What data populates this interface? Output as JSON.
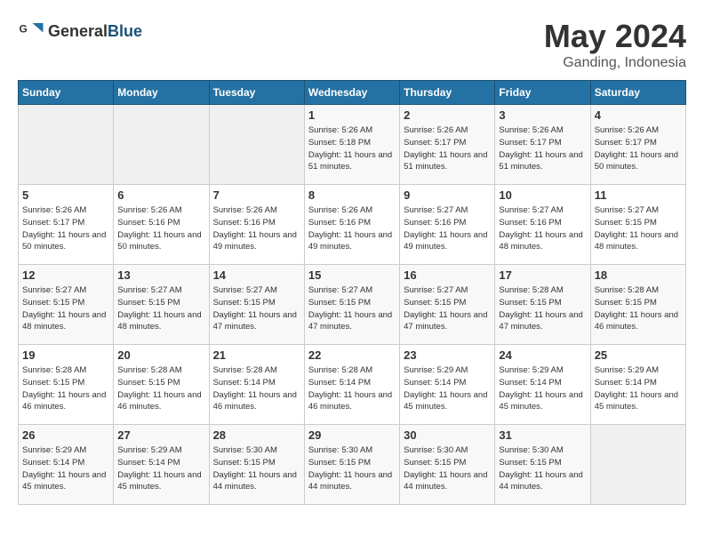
{
  "header": {
    "logo_general": "General",
    "logo_blue": "Blue",
    "month_title": "May 2024",
    "location": "Ganding, Indonesia"
  },
  "days_of_week": [
    "Sunday",
    "Monday",
    "Tuesday",
    "Wednesday",
    "Thursday",
    "Friday",
    "Saturday"
  ],
  "weeks": [
    {
      "cells": [
        {
          "empty": true
        },
        {
          "empty": true
        },
        {
          "empty": true
        },
        {
          "day": "1",
          "sunrise": "5:26 AM",
          "sunset": "5:18 PM",
          "daylight": "11 hours and 51 minutes."
        },
        {
          "day": "2",
          "sunrise": "5:26 AM",
          "sunset": "5:17 PM",
          "daylight": "11 hours and 51 minutes."
        },
        {
          "day": "3",
          "sunrise": "5:26 AM",
          "sunset": "5:17 PM",
          "daylight": "11 hours and 51 minutes."
        },
        {
          "day": "4",
          "sunrise": "5:26 AM",
          "sunset": "5:17 PM",
          "daylight": "11 hours and 50 minutes."
        }
      ]
    },
    {
      "cells": [
        {
          "day": "5",
          "sunrise": "5:26 AM",
          "sunset": "5:17 PM",
          "daylight": "11 hours and 50 minutes."
        },
        {
          "day": "6",
          "sunrise": "5:26 AM",
          "sunset": "5:16 PM",
          "daylight": "11 hours and 50 minutes."
        },
        {
          "day": "7",
          "sunrise": "5:26 AM",
          "sunset": "5:16 PM",
          "daylight": "11 hours and 49 minutes."
        },
        {
          "day": "8",
          "sunrise": "5:26 AM",
          "sunset": "5:16 PM",
          "daylight": "11 hours and 49 minutes."
        },
        {
          "day": "9",
          "sunrise": "5:27 AM",
          "sunset": "5:16 PM",
          "daylight": "11 hours and 49 minutes."
        },
        {
          "day": "10",
          "sunrise": "5:27 AM",
          "sunset": "5:16 PM",
          "daylight": "11 hours and 48 minutes."
        },
        {
          "day": "11",
          "sunrise": "5:27 AM",
          "sunset": "5:15 PM",
          "daylight": "11 hours and 48 minutes."
        }
      ]
    },
    {
      "cells": [
        {
          "day": "12",
          "sunrise": "5:27 AM",
          "sunset": "5:15 PM",
          "daylight": "11 hours and 48 minutes."
        },
        {
          "day": "13",
          "sunrise": "5:27 AM",
          "sunset": "5:15 PM",
          "daylight": "11 hours and 48 minutes."
        },
        {
          "day": "14",
          "sunrise": "5:27 AM",
          "sunset": "5:15 PM",
          "daylight": "11 hours and 47 minutes."
        },
        {
          "day": "15",
          "sunrise": "5:27 AM",
          "sunset": "5:15 PM",
          "daylight": "11 hours and 47 minutes."
        },
        {
          "day": "16",
          "sunrise": "5:27 AM",
          "sunset": "5:15 PM",
          "daylight": "11 hours and 47 minutes."
        },
        {
          "day": "17",
          "sunrise": "5:28 AM",
          "sunset": "5:15 PM",
          "daylight": "11 hours and 47 minutes."
        },
        {
          "day": "18",
          "sunrise": "5:28 AM",
          "sunset": "5:15 PM",
          "daylight": "11 hours and 46 minutes."
        }
      ]
    },
    {
      "cells": [
        {
          "day": "19",
          "sunrise": "5:28 AM",
          "sunset": "5:15 PM",
          "daylight": "11 hours and 46 minutes."
        },
        {
          "day": "20",
          "sunrise": "5:28 AM",
          "sunset": "5:15 PM",
          "daylight": "11 hours and 46 minutes."
        },
        {
          "day": "21",
          "sunrise": "5:28 AM",
          "sunset": "5:14 PM",
          "daylight": "11 hours and 46 minutes."
        },
        {
          "day": "22",
          "sunrise": "5:28 AM",
          "sunset": "5:14 PM",
          "daylight": "11 hours and 46 minutes."
        },
        {
          "day": "23",
          "sunrise": "5:29 AM",
          "sunset": "5:14 PM",
          "daylight": "11 hours and 45 minutes."
        },
        {
          "day": "24",
          "sunrise": "5:29 AM",
          "sunset": "5:14 PM",
          "daylight": "11 hours and 45 minutes."
        },
        {
          "day": "25",
          "sunrise": "5:29 AM",
          "sunset": "5:14 PM",
          "daylight": "11 hours and 45 minutes."
        }
      ]
    },
    {
      "cells": [
        {
          "day": "26",
          "sunrise": "5:29 AM",
          "sunset": "5:14 PM",
          "daylight": "11 hours and 45 minutes."
        },
        {
          "day": "27",
          "sunrise": "5:29 AM",
          "sunset": "5:14 PM",
          "daylight": "11 hours and 45 minutes."
        },
        {
          "day": "28",
          "sunrise": "5:30 AM",
          "sunset": "5:15 PM",
          "daylight": "11 hours and 44 minutes."
        },
        {
          "day": "29",
          "sunrise": "5:30 AM",
          "sunset": "5:15 PM",
          "daylight": "11 hours and 44 minutes."
        },
        {
          "day": "30",
          "sunrise": "5:30 AM",
          "sunset": "5:15 PM",
          "daylight": "11 hours and 44 minutes."
        },
        {
          "day": "31",
          "sunrise": "5:30 AM",
          "sunset": "5:15 PM",
          "daylight": "11 hours and 44 minutes."
        },
        {
          "empty": true
        }
      ]
    }
  ]
}
